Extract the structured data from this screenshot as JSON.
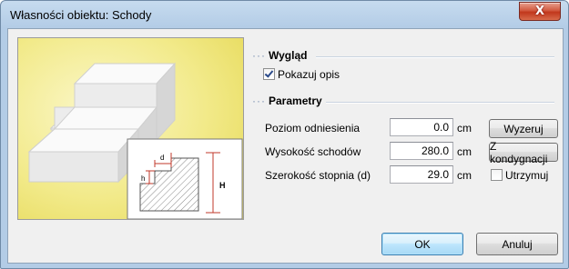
{
  "window": {
    "title": "Własności obiektu: Schody",
    "close_label": "X"
  },
  "appearance": {
    "group_label": "Wygląd",
    "show_description": {
      "label": "Pokazuj opis",
      "checked": true
    }
  },
  "parameters": {
    "group_label": "Parametry",
    "reference_level": {
      "label": "Poziom odniesienia",
      "value": "0.0",
      "unit": "cm",
      "button": "Wyzeruj"
    },
    "stairs_height": {
      "label": "Wysokość schodów",
      "value": "280.0",
      "unit": "cm",
      "button": "Z kondygnacji"
    },
    "step_width": {
      "label": "Szerokość stopnia (d)",
      "value": "29.0",
      "unit": "cm",
      "keep": {
        "label": "Utrzymuj",
        "checked": false
      }
    }
  },
  "preview": {
    "dim_d": "d",
    "dim_h": "h",
    "dim_H": "H"
  },
  "footer": {
    "ok": "OK",
    "cancel": "Anuluj"
  },
  "colors": {
    "preview_bg": "#f2ea8a",
    "step_face": "#f4f4f4",
    "accent_red": "#c0392b",
    "ok_border": "#3c7fb1"
  }
}
